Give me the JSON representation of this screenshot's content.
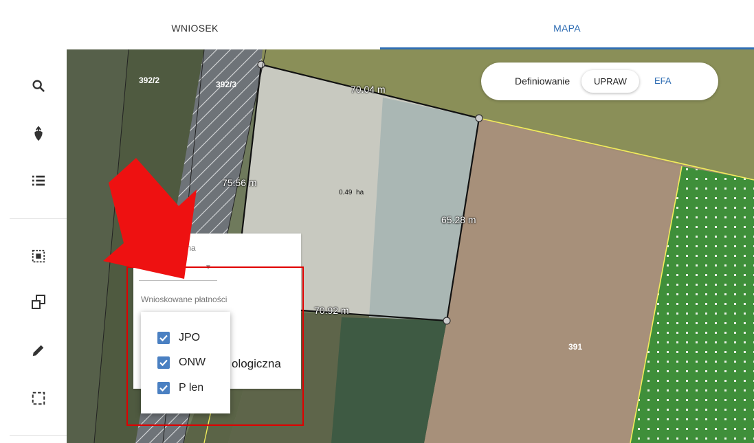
{
  "tabs": [
    {
      "label": "WNIOSEK"
    },
    {
      "label": "MAPA"
    }
  ],
  "map": {
    "parcels": [
      "392/2",
      "392/3",
      "391"
    ],
    "measurements": [
      "70.04 m",
      "75.56 m",
      "65.28 m",
      "70.92 m"
    ],
    "area": "0.49  ha"
  },
  "mode_toggle": {
    "label": "Definiowanie",
    "upraw": "UPRAW",
    "efa": "EFA"
  },
  "form": {
    "field1_label": "awna",
    "field1_value": "sty",
    "payments_label": "Wnioskowane płatności",
    "partial_text": "ologiczna"
  },
  "payments_options": [
    {
      "label": "JPO",
      "checked": true
    },
    {
      "label": "ONW",
      "checked": true
    },
    {
      "label": "P len",
      "checked": true
    }
  ],
  "colors": {
    "accent": "#2f6db3",
    "checkbox": "#4a80c2",
    "highlight": "#e00000"
  }
}
